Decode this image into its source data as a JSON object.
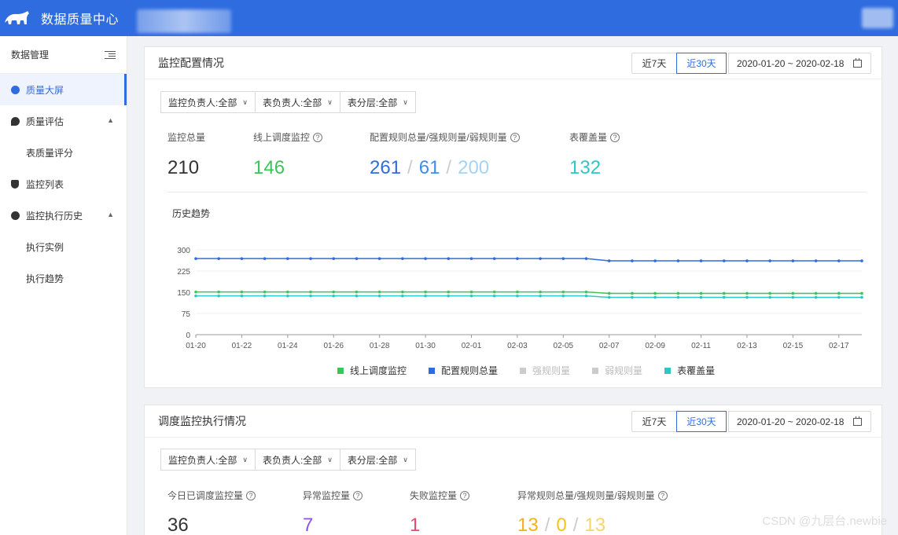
{
  "app": {
    "title": "数据质量中心"
  },
  "sidebar": {
    "header": "数据管理",
    "items": [
      {
        "label": "质量大屏",
        "active": true
      },
      {
        "label": "质量评估",
        "expanded": true
      },
      {
        "label": "表质量评分",
        "sub": true
      },
      {
        "label": "监控列表"
      },
      {
        "label": "监控执行历史",
        "expanded": true
      },
      {
        "label": "执行实例",
        "sub": true
      },
      {
        "label": "执行趋势",
        "sub": true
      }
    ]
  },
  "card1": {
    "title": "监控配置情况",
    "range_7": "近7天",
    "range_30": "近30天",
    "date_range": "2020-01-20 ~ 2020-02-18",
    "filters": [
      "监控负责人:全部",
      "表负责人:全部",
      "表分层:全部"
    ],
    "metrics": {
      "total_label": "监控总量",
      "total_value": "210",
      "online_label": "线上调度监控",
      "online_value": "146",
      "rules_label": "配置规则总量/强规则量/弱规则量",
      "rules_total": "261",
      "rules_strong": "61",
      "rules_weak": "200",
      "coverage_label": "表覆盖量",
      "coverage_value": "132"
    },
    "chart_title": "历史趋势"
  },
  "card2": {
    "title": "调度监控执行情况",
    "range_7": "近7天",
    "range_30": "近30天",
    "date_range": "2020-01-20 ~ 2020-02-18",
    "filters": [
      "监控负责人:全部",
      "表负责人:全部",
      "表分层:全部"
    ],
    "metrics": {
      "today_label": "今日已调度监控量",
      "today_value": "36",
      "abnormal_label": "异常监控量",
      "abnormal_value": "7",
      "failed_label": "失败监控量",
      "failed_value": "1",
      "abrules_label": "异常规则总量/强规则量/弱规则量",
      "abrules_total": "13",
      "abrules_strong": "0",
      "abrules_weak": "13"
    }
  },
  "colors": {
    "primary": "#2f6ce0",
    "online": "#3cc45a",
    "rules": "#2f6ce0",
    "strong": "#3f8cf0",
    "weak": "#a5d2f7",
    "coverage": "#2ec7c4",
    "abnormal": "#8a52e6",
    "failed": "#e84a6f",
    "warn": "#f6b21b",
    "warn_light": "#f9d36b"
  },
  "watermark": "CSDN @九层台.newbie",
  "chart_data": {
    "type": "line",
    "x": [
      "01-20",
      "01-21",
      "01-22",
      "01-23",
      "01-24",
      "01-25",
      "01-26",
      "01-27",
      "01-28",
      "01-29",
      "01-30",
      "01-31",
      "02-01",
      "02-02",
      "02-03",
      "02-04",
      "02-05",
      "02-06",
      "02-07",
      "02-08",
      "02-09",
      "02-10",
      "02-11",
      "02-12",
      "02-13",
      "02-14",
      "02-15",
      "02-16",
      "02-17",
      "02-18"
    ],
    "xticks": [
      "01-20",
      "01-22",
      "01-24",
      "01-26",
      "01-28",
      "01-30",
      "02-01",
      "02-03",
      "02-05",
      "02-07",
      "02-09",
      "02-11",
      "02-13",
      "02-15",
      "02-17"
    ],
    "yticks": [
      0,
      75,
      150,
      225,
      300
    ],
    "ylim": [
      0,
      300
    ],
    "series": [
      {
        "name": "线上调度监控",
        "color": "#3cc45a",
        "visible": true,
        "values": [
          151,
          151,
          151,
          151,
          151,
          151,
          151,
          151,
          151,
          151,
          151,
          151,
          151,
          151,
          151,
          151,
          151,
          151,
          146,
          146,
          146,
          146,
          146,
          146,
          146,
          146,
          146,
          146,
          146,
          146
        ]
      },
      {
        "name": "配置规则总量",
        "color": "#2f6ce0",
        "visible": true,
        "values": [
          269,
          269,
          269,
          269,
          269,
          269,
          269,
          269,
          269,
          269,
          269,
          269,
          269,
          269,
          269,
          269,
          269,
          269,
          261,
          261,
          261,
          261,
          261,
          261,
          261,
          261,
          261,
          261,
          261,
          261
        ]
      },
      {
        "name": "强规则量",
        "color": "#c4c4c4",
        "visible": false,
        "values": []
      },
      {
        "name": "弱规则量",
        "color": "#c4c4c4",
        "visible": false,
        "values": []
      },
      {
        "name": "表覆盖量",
        "color": "#2ec7c4",
        "visible": true,
        "values": [
          137,
          137,
          137,
          137,
          137,
          137,
          137,
          137,
          137,
          137,
          137,
          137,
          137,
          137,
          137,
          137,
          137,
          137,
          132,
          132,
          132,
          132,
          132,
          132,
          132,
          132,
          132,
          132,
          132,
          132
        ]
      }
    ]
  }
}
